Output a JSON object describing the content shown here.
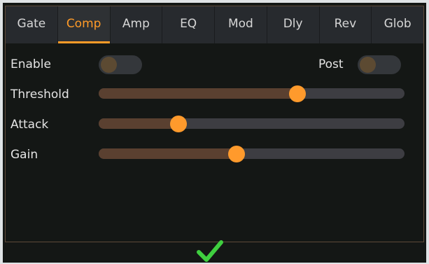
{
  "tabs": [
    {
      "label": "Gate",
      "active": false
    },
    {
      "label": "Comp",
      "active": true
    },
    {
      "label": "Amp",
      "active": false
    },
    {
      "label": "EQ",
      "active": false
    },
    {
      "label": "Mod",
      "active": false
    },
    {
      "label": "Dly",
      "active": false
    },
    {
      "label": "Rev",
      "active": false
    },
    {
      "label": "Glob",
      "active": false
    }
  ],
  "enable": {
    "label": "Enable",
    "on": false
  },
  "post": {
    "label": "Post",
    "on": false
  },
  "sliders": [
    {
      "label": "Threshold",
      "fraction": 0.65
    },
    {
      "label": "Attack",
      "fraction": 0.26
    },
    {
      "label": "Gain",
      "fraction": 0.45
    }
  ],
  "colors": {
    "accent": "#ff9b28",
    "confirm": "#3fcf3f",
    "background": "#141715"
  },
  "icons": {
    "confirm": "checkmark-icon"
  }
}
